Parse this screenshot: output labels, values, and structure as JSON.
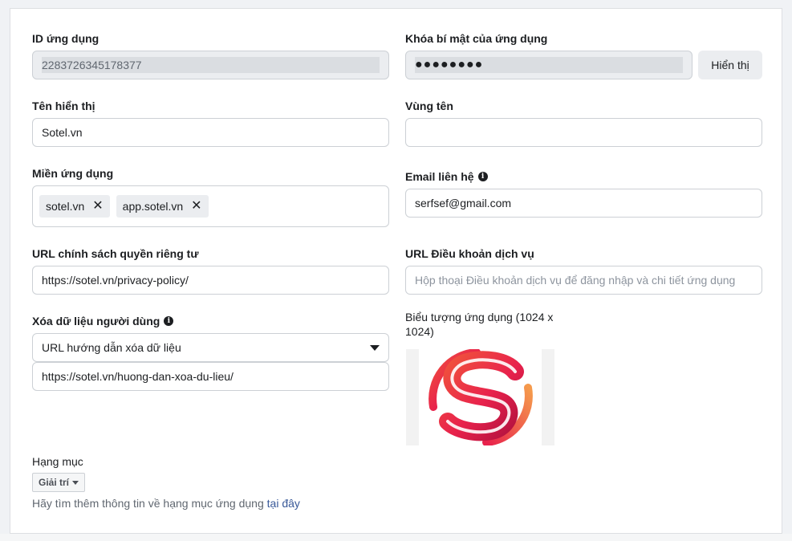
{
  "app_id": {
    "label": "ID ứng dụng",
    "value": "2283726345178377"
  },
  "app_secret": {
    "label": "Khóa bí mật của ứng dụng",
    "value": "●●●●●●●●",
    "show_button": "Hiển thị"
  },
  "display_name": {
    "label": "Tên hiển thị",
    "value": "Sotel.vn"
  },
  "namespace": {
    "label": "Vùng tên",
    "value": ""
  },
  "app_domains": {
    "label": "Miền ứng dụng",
    "tags": [
      "sotel.vn",
      "app.sotel.vn"
    ],
    "remove_glyph": "✕"
  },
  "contact_email": {
    "label": "Email liên hệ",
    "value": "serfsef@gmail.com"
  },
  "privacy_url": {
    "label": "URL chính sách quyền riêng tư",
    "value": "https://sotel.vn/privacy-policy/"
  },
  "tos_url": {
    "label": "URL Điều khoản dịch vụ",
    "placeholder": "Hộp thoại Điều khoản dịch vụ để đăng nhập và chi tiết ứng dụng"
  },
  "user_data_deletion": {
    "label": "Xóa dữ liệu người dùng",
    "select_value": "URL hướng dẫn xóa dữ liệu",
    "url": "https://sotel.vn/huong-dan-xoa-du-lieu/"
  },
  "app_icon": {
    "label": "Biểu tượng ứng dụng (1024 x 1024)",
    "colors": {
      "start": "#f0523c",
      "mid": "#e8224c",
      "end": "#b3123f"
    }
  },
  "category": {
    "label": "Hạng mục",
    "value": "Giải trí",
    "help_text": "Hãy tìm thêm thông tin về hạng mục ứng dụng ",
    "help_link": "tại đây"
  },
  "info_glyph": "i"
}
